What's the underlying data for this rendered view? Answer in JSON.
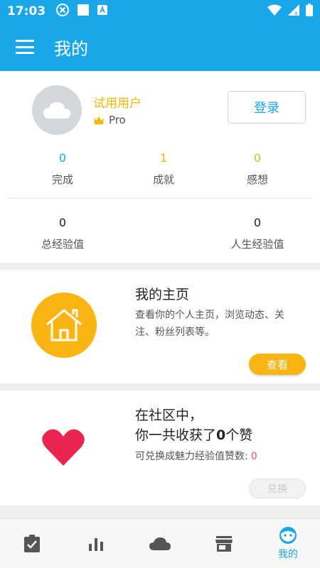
{
  "status_bar": {
    "time": "17:03"
  },
  "app_bar": {
    "title": "我的"
  },
  "profile": {
    "username": "试用用户",
    "badge": "Pro",
    "login_label": "登录",
    "stats": [
      {
        "value": "0",
        "label": "完成",
        "color": "#1aa7ea"
      },
      {
        "value": "1",
        "label": "成就",
        "color": "#f5b800"
      },
      {
        "value": "0",
        "label": "感想",
        "color": "#a8d22c"
      }
    ],
    "exp": [
      {
        "value": "0",
        "label": "总经验值"
      },
      {
        "value": "0",
        "label": "人生经验值"
      }
    ]
  },
  "homepage_card": {
    "title": "我的主页",
    "description": "查看你的个人主页，浏览动态、关注、粉丝列表等。",
    "button": "查看"
  },
  "community_card": {
    "line1": "在社区中，",
    "line2_prefix": "你一共收获了",
    "likes_count": "0",
    "line2_suffix": "个赞",
    "exchange_label": "可兑换成魅力经验值赞数:",
    "exchange_value": "0",
    "button": "兑换"
  },
  "bottom_nav": {
    "items": [
      {
        "icon": "clipboard-check-icon",
        "label": ""
      },
      {
        "icon": "bar-chart-icon",
        "label": ""
      },
      {
        "icon": "cloud-icon",
        "label": ""
      },
      {
        "icon": "store-icon",
        "label": ""
      },
      {
        "icon": "face-icon",
        "label": "我的",
        "active": true
      }
    ]
  },
  "colors": {
    "primary": "#1aa7ea",
    "accent": "#fbb513",
    "heart": "#e8264f"
  }
}
